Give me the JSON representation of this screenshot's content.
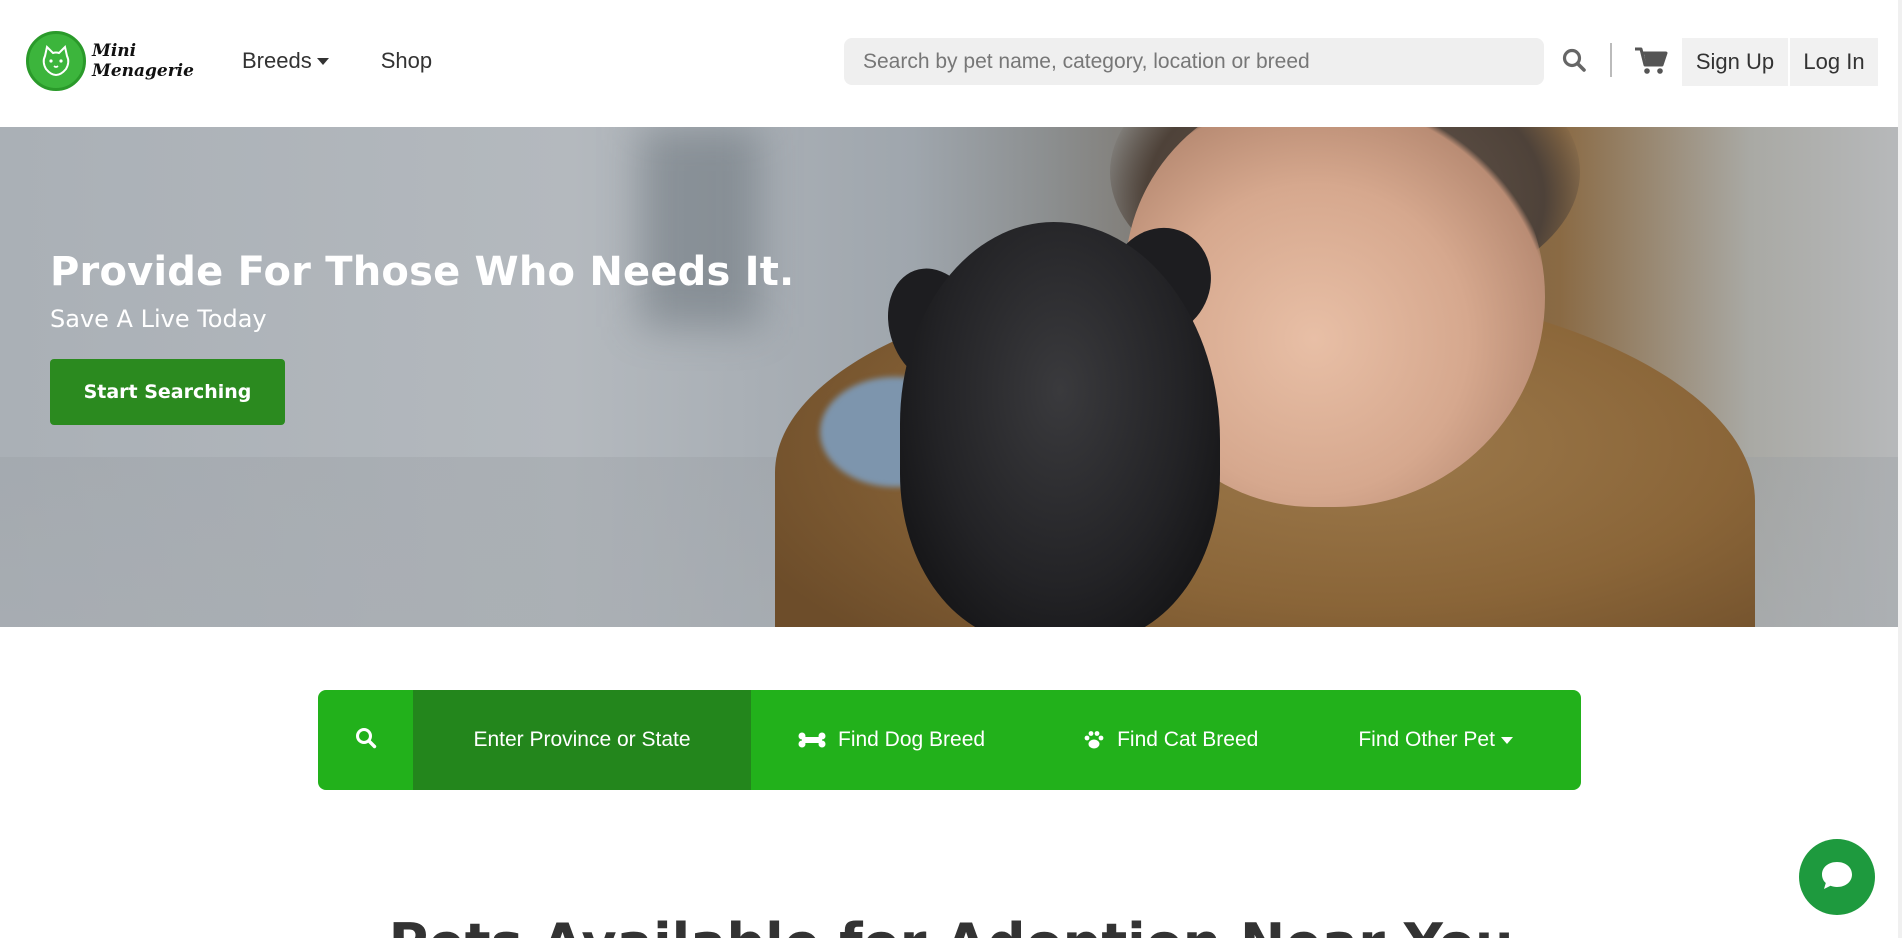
{
  "brand": {
    "line1": "Mini",
    "line2": "Menagerie"
  },
  "nav": {
    "breeds_label": "Breeds",
    "shop_label": "Shop"
  },
  "header_search": {
    "placeholder": "Search by pet name, category, location or breed"
  },
  "auth": {
    "signup_label": "Sign Up",
    "login_label": "Log In"
  },
  "hero": {
    "title": "Provide For Those Who Needs It.",
    "subtitle": "Save A Live Today",
    "cta_label": "Start Searching"
  },
  "pet_search": {
    "location_placeholder": "Enter Province or State",
    "dog_label": "Find Dog Breed",
    "cat_label": "Find Cat Breed",
    "other_label": "Find Other Pet"
  },
  "section": {
    "title": "Pets Available for Adoption Near You"
  },
  "colors": {
    "brand_green": "#22b11b",
    "dark_green": "#23861c",
    "cta_green": "#2b8a1f",
    "chat_green": "#1e9a3e"
  },
  "icons": [
    "cat-logo-icon",
    "chevron-down-icon",
    "search-icon",
    "cart-icon",
    "bone-icon",
    "paw-icon",
    "chat-bubble-icon"
  ]
}
